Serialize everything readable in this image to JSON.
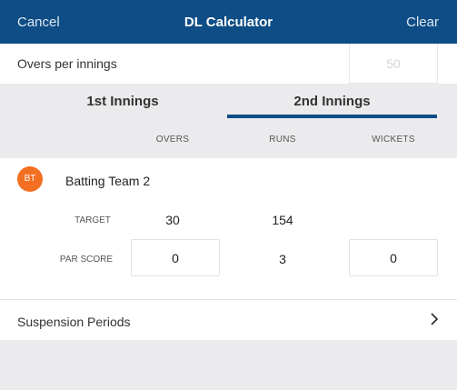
{
  "header": {
    "cancel_label": "Cancel",
    "title": "DL Calculator",
    "clear_label": "Clear"
  },
  "settings": {
    "overs_label": "Overs per innings",
    "overs_placeholder": "50"
  },
  "tabs": [
    {
      "label": "1st Innings",
      "active": false
    },
    {
      "label": "2nd Innings",
      "active": true
    }
  ],
  "columns": {
    "overs": "OVERS",
    "runs": "RUNS",
    "wickets": "WICKETS"
  },
  "team": {
    "initials": "BT",
    "name": "Batting Team 2",
    "avatar_color": "#f36f21",
    "target": {
      "label": "TARGET",
      "overs": "30",
      "runs": "154"
    },
    "par_score": {
      "label": "PAR SCORE",
      "overs": "0",
      "runs": "3",
      "wickets": "0"
    }
  },
  "suspension": {
    "label": "Suspension Periods"
  },
  "colors": {
    "header_bg": "#0e4d85",
    "tab_indicator": "#0e4d85",
    "page_bg": "#ebebed"
  }
}
